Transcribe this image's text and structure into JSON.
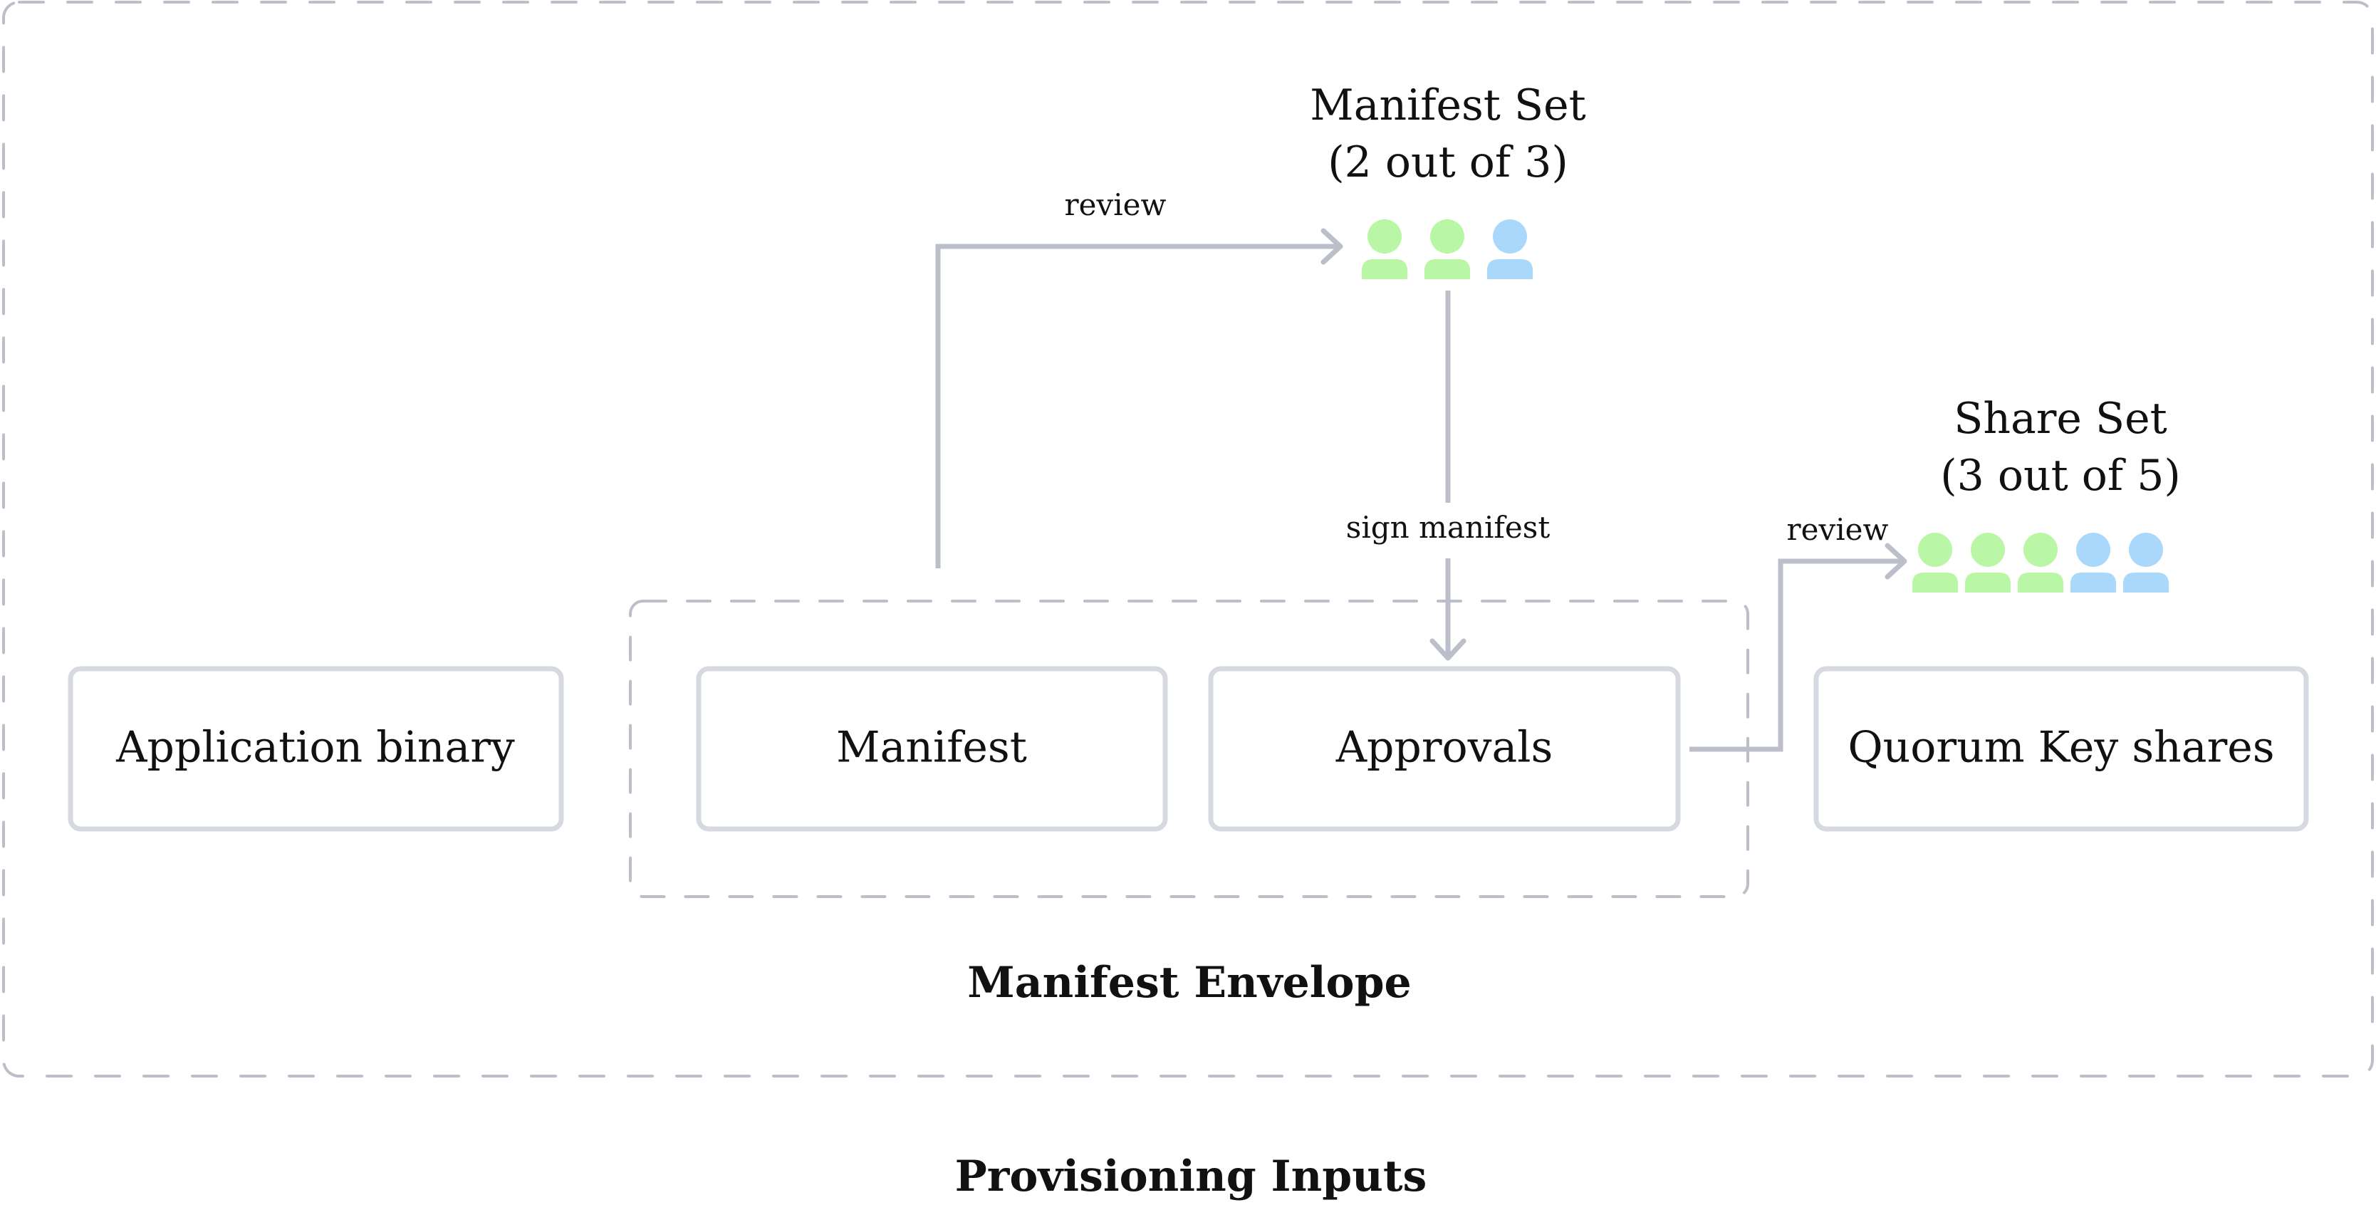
{
  "colors": {
    "dashed_border": "#bcbfc9",
    "box_border": "#d6d9e2",
    "arrow": "#bcbfc9",
    "approved_member": "#b9f6a6",
    "pending_member": "#aad8fb",
    "text": "#111111"
  },
  "outer_container": {
    "label": "Provisioning Inputs"
  },
  "envelope": {
    "label": "Manifest Envelope"
  },
  "boxes": [
    {
      "id": "application-binary",
      "label": "Application binary"
    },
    {
      "id": "manifest",
      "label": "Manifest"
    },
    {
      "id": "approvals",
      "label": "Approvals"
    },
    {
      "id": "quorum-key-shares",
      "label": "Quorum Key shares"
    }
  ],
  "manifest_set": {
    "title": "Manifest Set",
    "threshold": "(2 out of 3)",
    "members": [
      "approved",
      "approved",
      "pending"
    ]
  },
  "share_set": {
    "title": "Share Set",
    "threshold": "(3 out of 5)",
    "members": [
      "approved",
      "approved",
      "approved",
      "pending",
      "pending"
    ]
  },
  "edges": [
    {
      "from": "manifest",
      "to": "manifest_set",
      "label": "review"
    },
    {
      "from": "manifest_set",
      "to": "approvals",
      "label": "sign manifest"
    },
    {
      "from": "approvals",
      "to": "share_set",
      "label": "review"
    }
  ]
}
